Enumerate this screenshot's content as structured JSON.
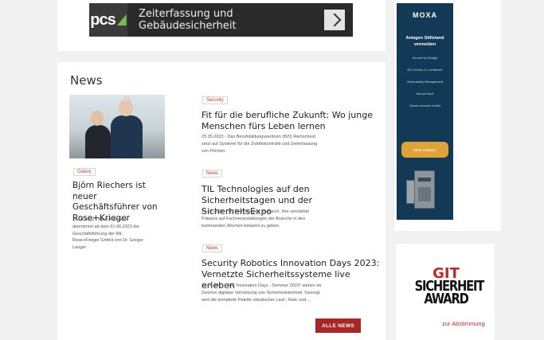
{
  "top_banner": {
    "logo": "pcs",
    "text": "Zeiterfassung und Gebäudesicherheit"
  },
  "news": {
    "title": "News",
    "featured": {
      "tag": "Galery",
      "headline_lines": [
        "Björn Riechers ist neuer",
        "Geschäftsführer von",
        "Rose+Krieger"
      ],
      "excerpt_lines": [
        "25.05.2023 - Björn Riechers",
        "übernimmt ab dem 01.06.2023 die",
        "Geschäftsführung der RK",
        "Rose+Krieger GmbH von Dr. Gregor",
        "Langer."
      ]
    },
    "items": [
      {
        "tag": "Security",
        "headline_lines": [
          "Fit für die berufliche Zukunft: Wo junge",
          "Menschen fürs Leben lernen"
        ],
        "excerpt_lines": [
          "25.05.2023 - Das Berufsbildungszentrum (BZI) Remscheid",
          "setzt auf Systeme für die Zutrittskontrolle und Zeiterfassung",
          "von Primion."
        ]
      },
      {
        "tag": "News",
        "headline_lines": [
          "TIL Technologies auf den",
          "Sicherheitstagen und der SicherheitsExpo"
        ],
        "excerpt_lines": [
          "24.05.2023 - TIL Technologies freut sich, ihre verstärkte",
          "Präsenz auf Fachveranstaltungen der Branche in den",
          "kommenden Wochen bekannt zu geben."
        ]
      },
      {
        "tag": "News",
        "headline_lines": [
          "Security Robotics Innovation Days 2023:",
          "Vernetzte Sicherheitssysteme live erleben"
        ],
        "excerpt_lines": [
          "23.05.2023 - Die \"Innovation Days - Sommer 2023\" stehen im",
          "Zeichen digitaler Vernetzung von Sicherheitstechnik: Gezeigt",
          "wird die komplette Palette robotischer Lauf-, Rad- und..."
        ]
      }
    ],
    "all_news_label": "ALLE NEWS"
  },
  "moxa_ad": {
    "logo": "MOXA",
    "headline_lines": [
      "Anlagen Stillstand",
      "vermeiden"
    ],
    "features": [
      "Secure by Design",
      "IEC 62443-4-1 zertifiziert",
      "Vulnerability Management",
      "Secure Boot",
      "Secure Access Toolkit"
    ],
    "button": "Mehr erfahren"
  },
  "git_award": {
    "lines": [
      "GIT",
      "SICHERHEIT",
      "AWARD"
    ],
    "vote_link": "zur Abstimmung"
  },
  "colors": {
    "accent": "#a82626",
    "moxa_blue": "#123a57",
    "moxa_button": "#e0a33a"
  }
}
